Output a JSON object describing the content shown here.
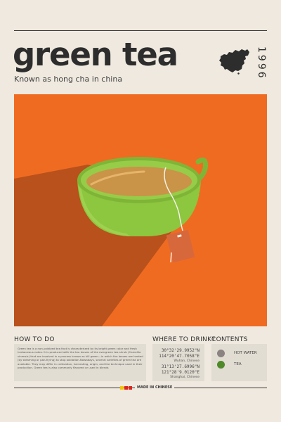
{
  "header": {
    "title": "green tea",
    "subtitle": "Known as hong cha in china",
    "year": "1996",
    "map_icon": "china-map-icon"
  },
  "illustration": {
    "icon": "green-teacup-with-teabag-illustration",
    "background_color": "#f06b22",
    "shadow_color": "#b8511b",
    "cup_color": "#8dc63f",
    "tea_color": "#c99447",
    "tag_color": "#d7683b"
  },
  "how_to_do": {
    "heading": "HOW TO DO",
    "description": "Green tea is a non-oxidized tea that is characterized by its bright green color and fresh herbaceous notes. It is produced with the tea leaves of the evergreen tea shrub (Camellia sinensis) that are involved in a process known as kill green—in which the leaves are heated (by steaming or pan-frying) to stop oxidation.Nowadays, several varieties of green tea are available. They may differ in cultivation, harvesting, origin, and the technique used in their production. Green tea is also commonly flavored or used in blends"
  },
  "where_to_drink": {
    "heading": "WHERE TO DRINK?",
    "locations": [
      {
        "coord1": "30°32'29.9952\"N",
        "coord2": "114°20'47.7058\"E",
        "city": "Wuhan, Chinese"
      },
      {
        "coord1": "31°13'27.6996\"N",
        "coord2": "121°28'9.0120\"E",
        "city": "Shanghai, Chinese"
      }
    ]
  },
  "contents": {
    "heading": "CONTENTS",
    "items": [
      {
        "label": "HOT WATER",
        "color": "#8a8382"
      },
      {
        "label": "TEA",
        "color": "#4f8a2a"
      }
    ]
  },
  "footer": {
    "made_in": "MADE IN CHINESE",
    "flag_colors": [
      "#f5c400",
      "#d9261c",
      "#d9261c"
    ]
  }
}
